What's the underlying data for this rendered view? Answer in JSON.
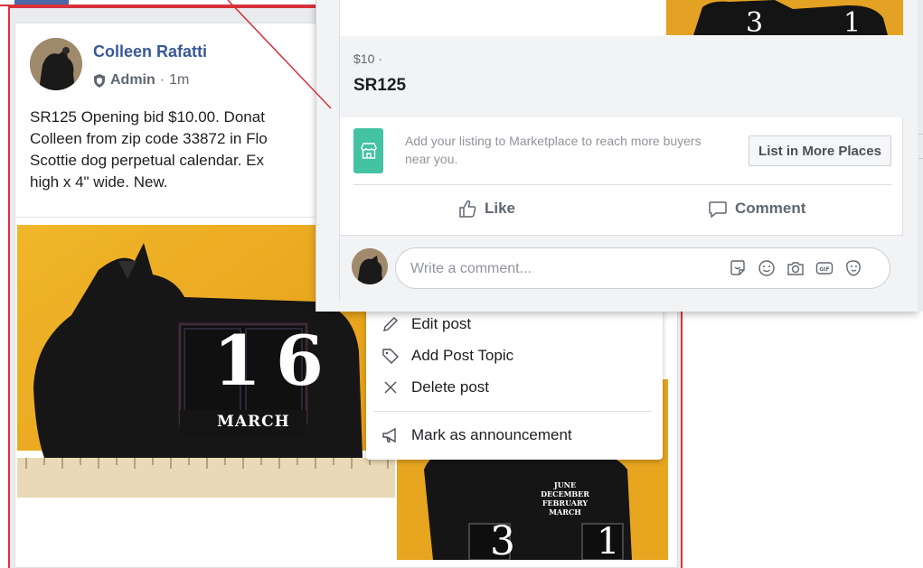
{
  "post": {
    "author": "Colleen Rafatti",
    "role": "Admin",
    "time": "1m",
    "text_lines": [
      "SR125 Opening bid $10.00. Donat",
      "Colleen from zip code 33872 in Flo",
      "Scottie dog perpetual calendar. Ex",
      "high x 4\" wide. New."
    ]
  },
  "calendar_photo": {
    "day_digits": [
      "1",
      "6"
    ],
    "month": "MARCH",
    "months_list": [
      "JUNE",
      "DECEMBER",
      "FEBRUARY",
      "MARCH"
    ],
    "side_digits": [
      "3",
      "1"
    ]
  },
  "context_menu": {
    "items": [
      {
        "label": "Edit post",
        "icon": "pencil-icon"
      },
      {
        "label": "Add Post Topic",
        "icon": "tag-icon"
      },
      {
        "label": "Delete post",
        "icon": "x-icon"
      },
      {
        "label": "Mark as announcement",
        "icon": "megaphone-icon"
      }
    ]
  },
  "marketplace": {
    "price": "$10 ·",
    "title": "SR125",
    "prompt_line1": "Add your listing to Marketplace to reach more buyers",
    "prompt_line2": "near you.",
    "list_button": "List in More Places",
    "like_label": "Like",
    "comment_label": "Comment",
    "comment_placeholder": "Write a comment..."
  },
  "colors": {
    "link_blue": "#385898",
    "marketplace_green": "#43c2a4",
    "annotation_red": "#d8313a"
  }
}
